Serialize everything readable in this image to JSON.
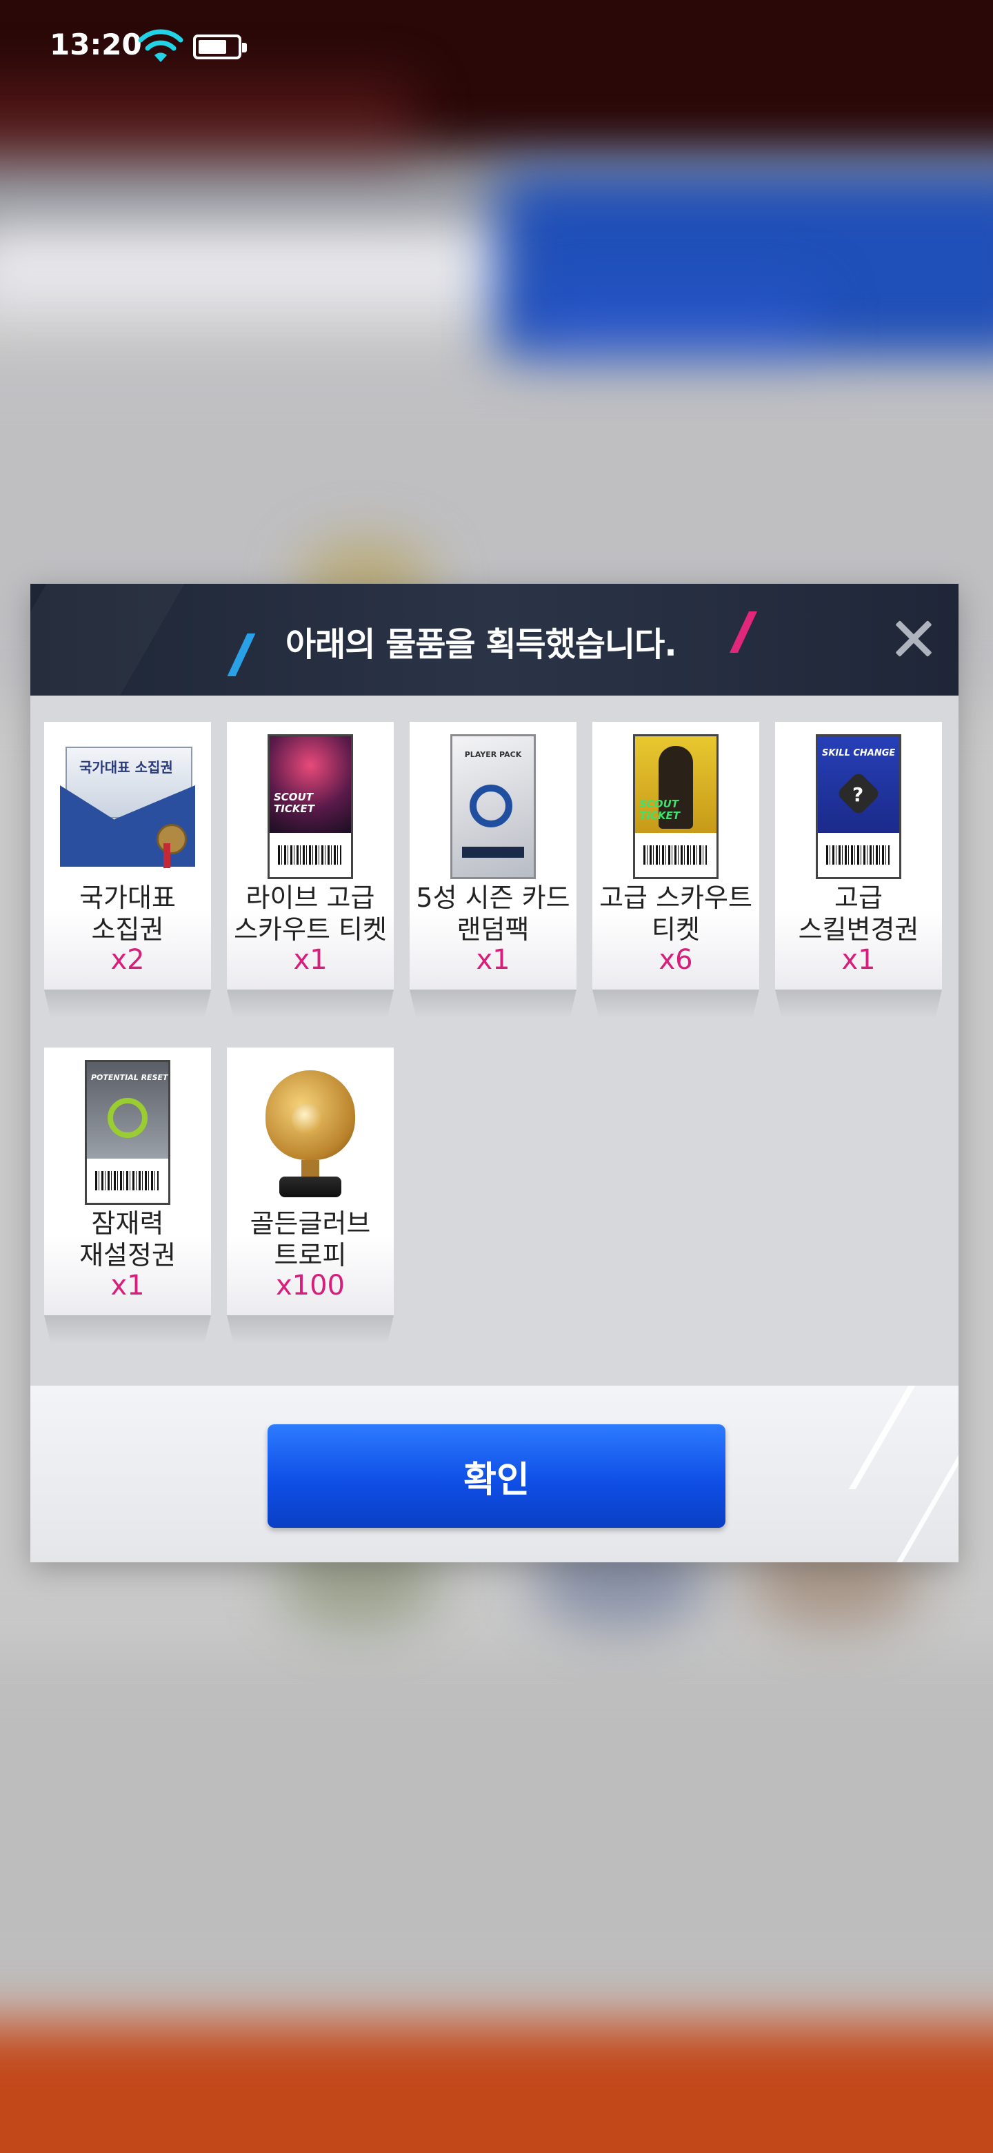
{
  "status_bar": {
    "time": "13:20"
  },
  "dialog": {
    "title": "아래의 물품을 획득했습니다.",
    "confirm_label": "확인",
    "items": [
      {
        "name": "국가대표\n소집권",
        "qty": "x2",
        "icon": "national-team-envelope-icon",
        "thumb_text": "국가대표 소집권"
      },
      {
        "name": "라이브 고급\n스카우트 티켓",
        "qty": "x1",
        "icon": "live-scout-ticket-icon",
        "thumb_text": "SCOUT TICKET"
      },
      {
        "name": "5성 시즌 카드\n랜덤팩",
        "qty": "x1",
        "icon": "player-pack-icon",
        "thumb_text": "PLAYER PACK"
      },
      {
        "name": "고급 스카우트\n티켓",
        "qty": "x6",
        "icon": "scout-ticket-icon",
        "thumb_text": "SCOUT TICKET"
      },
      {
        "name": "고급\n스킬변경권",
        "qty": "x1",
        "icon": "skill-change-ticket-icon",
        "thumb_text": "SKILL CHANGE"
      },
      {
        "name": "잠재력\n재설정권",
        "qty": "x1",
        "icon": "potential-reset-ticket-icon",
        "thumb_text": "POTENTIAL RESET"
      },
      {
        "name": "골든글러브\n트로피",
        "qty": "x100",
        "icon": "golden-glove-trophy-icon"
      }
    ]
  },
  "colors": {
    "accent_pink": "#d81e7a",
    "confirm_blue": "#1458ef",
    "header_dark": "#262e40"
  }
}
